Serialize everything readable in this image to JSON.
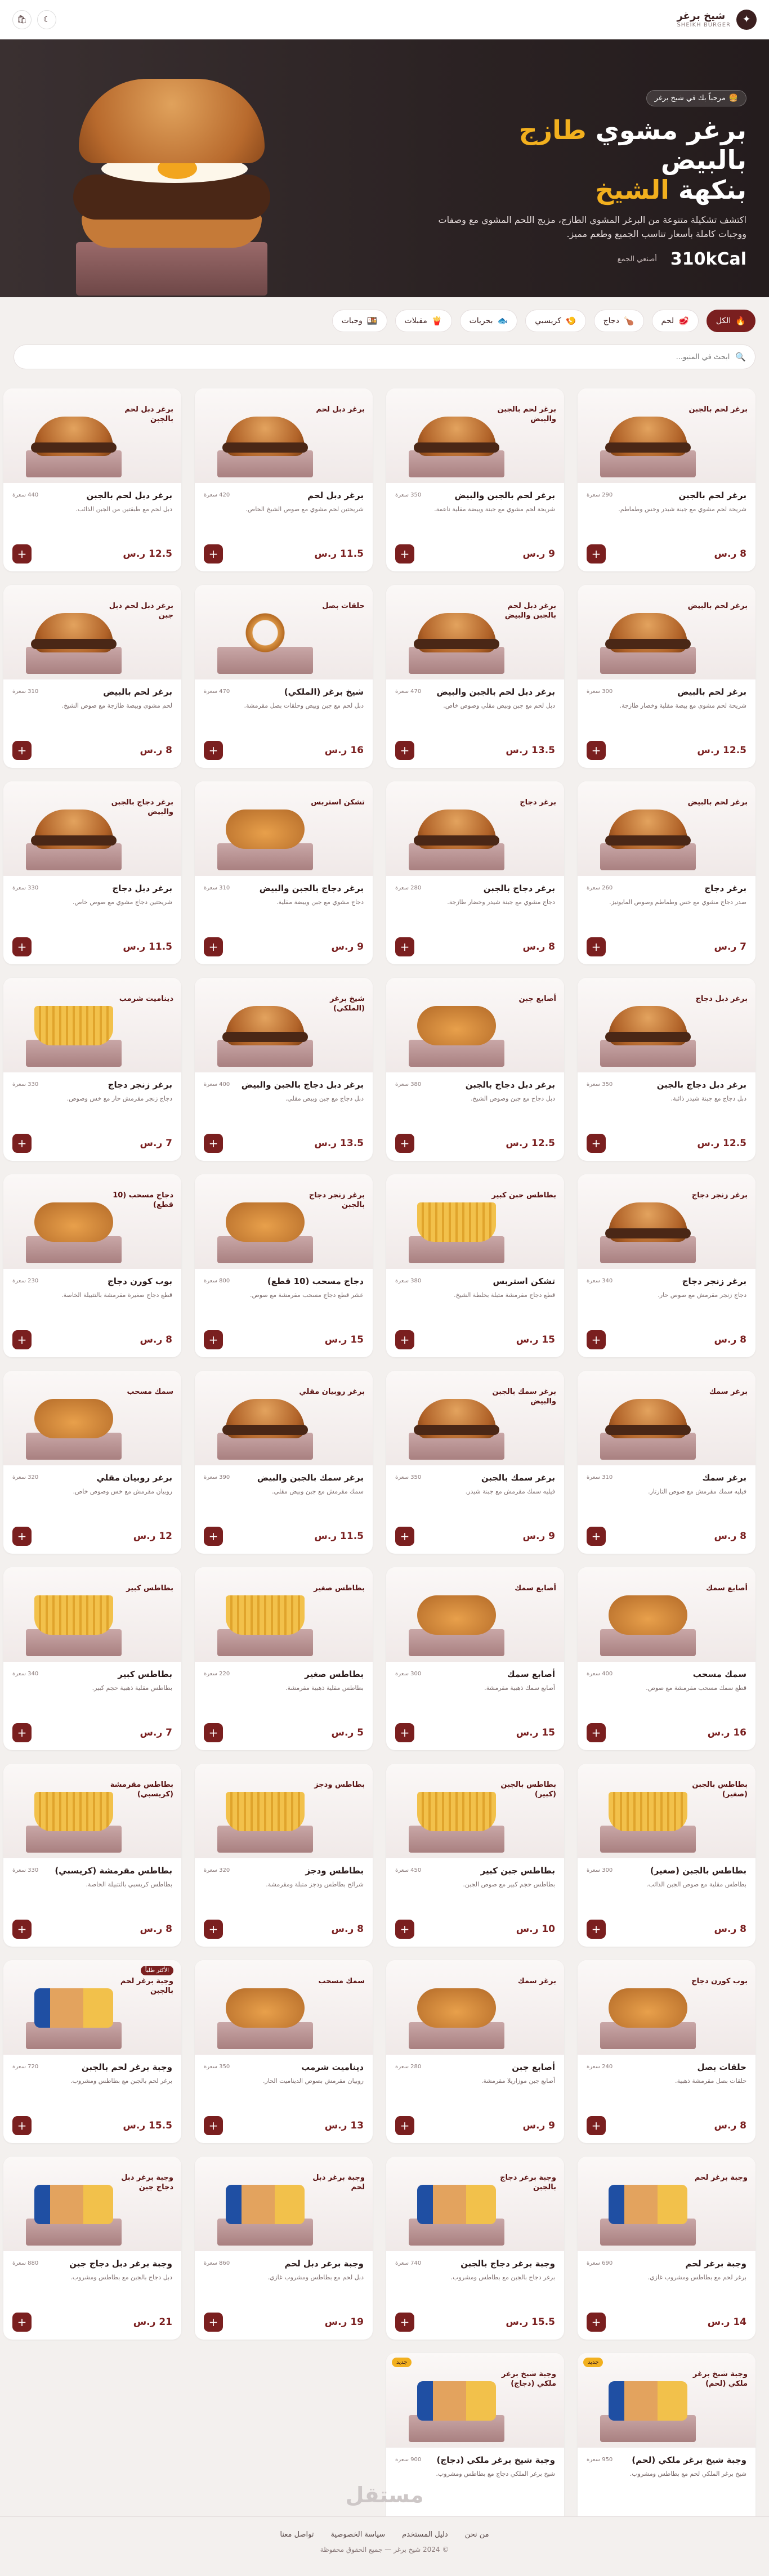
{
  "header": {
    "brand_ar": "شيخ برغر",
    "brand_en": "SHEIKH BURGER",
    "cart_icon": "bag-icon",
    "theme_icon": "moon-icon"
  },
  "hero": {
    "badge": "مرحباً بك في شيخ برغر",
    "title_line1": "برغر مشوي",
    "title_accent1": "طازج",
    "title_line1b": "بالبيض",
    "title_line2": "بنكهة",
    "title_accent2": "الشيخ",
    "description": "اكتشف تشكيلة متنوعة من البرغر المشوي الطازج، مزيج اللحم المشوي مع وصفات ووجبات كاملة بأسعار تناسب الجميع وطعم مميز.",
    "kcal": "310kCal",
    "note": "أصنعي الجمع"
  },
  "categories": [
    {
      "label": "الكل",
      "active": true,
      "icon": "fire-icon",
      "glyph": "🔥"
    },
    {
      "label": "لحم",
      "active": false,
      "icon": "meat-icon",
      "glyph": "🥩"
    },
    {
      "label": "دجاج",
      "active": false,
      "icon": "chicken-icon",
      "glyph": "🍗"
    },
    {
      "label": "كريسبي",
      "active": false,
      "icon": "crispy-icon",
      "glyph": "🍤"
    },
    {
      "label": "بحريات",
      "active": false,
      "icon": "fish-icon",
      "glyph": "🐟"
    },
    {
      "label": "مقبلات",
      "active": false,
      "icon": "fries-icon",
      "glyph": "🍟"
    },
    {
      "label": "وجبات",
      "active": false,
      "icon": "meal-icon",
      "glyph": "🍱"
    }
  ],
  "search": {
    "placeholder": "ابحث في المنيو..."
  },
  "products": [
    {
      "name": "برغر لحم بالجبن",
      "label": "برغر لحم بالجبن",
      "kcal": "290 سعرة",
      "desc": "شريحة لحم مشوي مع جبنة شيدر وخس وطماطم.",
      "price": "8 ر.س",
      "food": "burger"
    },
    {
      "name": "برغر لحم بالجبن والبيض",
      "label": "برغر لحم بالجبن والبيض",
      "kcal": "350 سعرة",
      "desc": "شريحة لحم مشوي مع جبنة وبيضة مقلية ناعمة.",
      "price": "9 ر.س",
      "food": "burger"
    },
    {
      "name": "برغر دبل لحم",
      "label": "برغر دبل لحم",
      "kcal": "420 سعرة",
      "desc": "شريحتين لحم مشوي مع صوص الشيخ الخاص.",
      "price": "11.5 ر.س",
      "food": "burger"
    },
    {
      "name": "برغر دبل لحم بالجبن",
      "label": "برغر دبل لحم بالجبن",
      "kcal": "440 سعرة",
      "desc": "دبل لحم مع طبقتين من الجبن الذائب.",
      "price": "12.5 ر.س",
      "food": "burger"
    },
    {
      "name": "برغر لحم بالبيض",
      "label": "برغر لحم بالبيض",
      "kcal": "300 سعرة",
      "desc": "شريحة لحم مشوي مع بيضة مقلية وخضار طازجة.",
      "price": "12.5 ر.س",
      "food": "burger"
    },
    {
      "name": "برغر دبل لحم بالجبن والبيض",
      "label": "برغر دبل لحم بالجبن والبيض",
      "kcal": "470 سعرة",
      "desc": "دبل لحم مع جبن وبيض مقلي وصوص خاص.",
      "price": "13.5 ر.س",
      "food": "burger"
    },
    {
      "name": "شيخ برغر (الملكي)",
      "label": "حلقات بصل",
      "kcal": "470 سعرة",
      "desc": "دبل لحم مع جبن وبيض وحلقات بصل مقرمشة.",
      "price": "16 ر.س",
      "food": "rings"
    },
    {
      "name": "برغر لحم بالبيض",
      "label": "برغر دبل لحم دبل جبن",
      "kcal": "310 سعرة",
      "desc": "لحم مشوي وبيضة طازجة مع صوص الشيخ.",
      "price": "8 ر.س",
      "food": "burger"
    },
    {
      "name": "برغر دجاج",
      "label": "برغر لحم بالبيض",
      "kcal": "260 سعرة",
      "desc": "صدر دجاج مشوي مع خس وطماطم وصوص المايونيز.",
      "price": "7 ر.س",
      "food": "burger"
    },
    {
      "name": "برغر دجاج بالجبن",
      "label": "برغر دجاج",
      "kcal": "280 سعرة",
      "desc": "دجاج مشوي مع جبنة شيدر وخضار طازجة.",
      "price": "8 ر.س",
      "food": "burger"
    },
    {
      "name": "برغر دجاج بالجبن والبيض",
      "label": "تشكن استربس",
      "kcal": "310 سعرة",
      "desc": "دجاج مشوي مع جبن وبيضة مقلية.",
      "price": "9 ر.س",
      "food": "strips"
    },
    {
      "name": "برغر دبل دجاج",
      "label": "برغر دجاج بالجبن والبيض",
      "kcal": "330 سعرة",
      "desc": "شريحتين دجاج مشوي مع صوص خاص.",
      "price": "11.5 ر.س",
      "food": "burger"
    },
    {
      "name": "برغر دبل دجاج بالجبن",
      "label": "برغر دبل دجاج",
      "kcal": "350 سعرة",
      "desc": "دبل دجاج مع جبنة شيدر ذائبة.",
      "price": "12.5 ر.س",
      "food": "burger"
    },
    {
      "name": "برغر دبل دجاج بالجبن",
      "label": "أصابع جبن",
      "kcal": "380 سعرة",
      "desc": "دبل دجاج مع جبن وصوص الشيخ.",
      "price": "12.5 ر.س",
      "food": "strips"
    },
    {
      "name": "برغر دبل دجاج بالجبن والبيض",
      "label": "شيخ برغر (الملكي)",
      "kcal": "400 سعرة",
      "desc": "دبل دجاج مع جبن وبيض مقلي.",
      "price": "13.5 ر.س",
      "food": "burger"
    },
    {
      "name": "برغر زنجر دجاج",
      "label": "ديناميت شرمب",
      "kcal": "330 سعرة",
      "desc": "دجاج زنجر مقرمش حار مع خس وصوص.",
      "price": "7 ر.س",
      "food": "fries"
    },
    {
      "name": "برغر زنجر دجاج",
      "label": "برغر زنجر دجاج",
      "kcal": "340 سعرة",
      "desc": "دجاج زنجر مقرمش مع صوص حار.",
      "price": "8 ر.س",
      "food": "burger"
    },
    {
      "name": "تشكن استربس",
      "label": "بطاطس جبن كبير",
      "kcal": "380 سعرة",
      "desc": "قطع دجاج مقرمشة متبلة بخلطة الشيخ.",
      "price": "15 ر.س",
      "food": "fries"
    },
    {
      "name": "دجاج مسحب (10 قطع)",
      "label": "برغر زنجر دجاج بالجبن",
      "kcal": "800 سعرة",
      "desc": "عشر قطع دجاج مسحب مقرمشة مع صوص.",
      "price": "15 ر.س",
      "food": "strips"
    },
    {
      "name": "بوب كورن دجاج",
      "label": "دجاج مسحب (10 قطع)",
      "kcal": "230 سعرة",
      "desc": "قطع دجاج صغيرة مقرمشة بالتتبيلة الخاصة.",
      "price": "8 ر.س",
      "food": "strips"
    },
    {
      "name": "برغر سمك",
      "label": "برغر سمك",
      "kcal": "310 سعرة",
      "desc": "فيليه سمك مقرمش مع صوص التارتار.",
      "price": "8 ر.س",
      "food": "burger"
    },
    {
      "name": "برغر سمك بالجبن",
      "label": "برغر سمك بالجبن والبيض",
      "kcal": "350 سعرة",
      "desc": "فيليه سمك مقرمش مع جبنة شيدر.",
      "price": "9 ر.س",
      "food": "burger"
    },
    {
      "name": "برغر سمك بالجبن والبيض",
      "label": "برغر روبيان مقلي",
      "kcal": "390 سعرة",
      "desc": "سمك مقرمش مع جبن وبيض مقلي.",
      "price": "11.5 ر.س",
      "food": "burger"
    },
    {
      "name": "برغر روبيان مقلي",
      "label": "سمك مسحب",
      "kcal": "320 سعرة",
      "desc": "روبيان مقرمش مع خس وصوص خاص.",
      "price": "12 ر.س",
      "food": "strips"
    },
    {
      "name": "سمك مسحب",
      "label": "أصابع سمك",
      "kcal": "400 سعرة",
      "desc": "قطع سمك مسحب مقرمشة مع صوص.",
      "price": "16 ر.س",
      "food": "strips"
    },
    {
      "name": "أصابع سمك",
      "label": "أصابع سمك",
      "kcal": "300 سعرة",
      "desc": "أصابع سمك ذهبية مقرمشة.",
      "price": "15 ر.س",
      "food": "strips"
    },
    {
      "name": "بطاطس صغير",
      "label": "بطاطس صغير",
      "kcal": "220 سعرة",
      "desc": "بطاطس مقلية ذهبية مقرمشة.",
      "price": "5 ر.س",
      "food": "fries"
    },
    {
      "name": "بطاطس كبير",
      "label": "بطاطس كبير",
      "kcal": "340 سعرة",
      "desc": "بطاطس مقلية ذهبية حجم كبير.",
      "price": "7 ر.س",
      "food": "fries"
    },
    {
      "name": "بطاطس بالجبن (صغير)",
      "label": "بطاطس بالجبن (صغير)",
      "kcal": "300 سعرة",
      "desc": "بطاطس مقلية مع صوص الجبن الذائب.",
      "price": "8 ر.س",
      "food": "fries"
    },
    {
      "name": "بطاطس جبن كبير",
      "label": "بطاطس بالجبن (كبير)",
      "kcal": "450 سعرة",
      "desc": "بطاطس حجم كبير مع صوص الجبن.",
      "price": "10 ر.س",
      "food": "fries"
    },
    {
      "name": "بطاطس ودجز",
      "label": "بطاطس ودجز",
      "kcal": "320 سعرة",
      "desc": "شرائح بطاطس ودجز متبلة ومقرمشة.",
      "price": "8 ر.س",
      "food": "fries"
    },
    {
      "name": "بطاطس مقرمشة (كريسبي)",
      "label": "بطاطس مقرمشة (كريسبي)",
      "kcal": "330 سعرة",
      "desc": "بطاطس كريسبي بالتتبيلة الخاصة.",
      "price": "8 ر.س",
      "food": "fries"
    },
    {
      "name": "حلقات بصل",
      "label": "بوب كورن دجاج",
      "kcal": "240 سعرة",
      "desc": "حلقات بصل مقرمشة ذهبية.",
      "price": "8 ر.س",
      "food": "strips"
    },
    {
      "name": "أصابع جبن",
      "label": "برغر سمك",
      "kcal": "280 سعرة",
      "desc": "أصابع جبن موزاريلا مقرمشة.",
      "price": "9 ر.س",
      "food": "strips"
    },
    {
      "name": "ديناميت شرمب",
      "label": "سمك مسحب",
      "kcal": "350 سعرة",
      "desc": "روبيان مقرمش بصوص الديناميت الحار.",
      "price": "13 ر.س",
      "food": "strips"
    },
    {
      "name": "وجبة برغر لحم بالجبن",
      "label": "وجبة برغر لحم بالجبن",
      "badge": "الأكثر طلباً",
      "kcal": "720 سعرة",
      "desc": "برغر لحم بالجبن مع بطاطس ومشروب.",
      "price": "15.5 ر.س",
      "food": "combo"
    },
    {
      "name": "وجبة برغر لحم",
      "label": "وجبة برغر لحم",
      "kcal": "690 سعرة",
      "desc": "برغر لحم مع بطاطس ومشروب غازي.",
      "price": "14 ر.س",
      "food": "combo"
    },
    {
      "name": "وجبة برغر دجاج بالجبن",
      "label": "وجبة برغر دجاج بالجبن",
      "kcal": "740 سعرة",
      "desc": "برغر دجاج بالجبن مع بطاطس ومشروب.",
      "price": "15.5 ر.س",
      "food": "combo"
    },
    {
      "name": "وجبة برغر دبل لحم",
      "label": "وجبة برغر دبل لحم",
      "kcal": "860 سعرة",
      "desc": "دبل لحم مع بطاطس ومشروب غازي.",
      "price": "19 ر.س",
      "food": "combo"
    },
    {
      "name": "وجبة برغر دبل دجاج جبن",
      "label": "وجبة برغر دبل دجاج جبن",
      "kcal": "880 سعرة",
      "desc": "دبل دجاج بالجبن مع بطاطس ومشروب.",
      "price": "21 ر.س",
      "food": "combo"
    },
    {
      "name": "وجبة شيخ برغر ملكي (لحم)",
      "label": "وجبة شيخ برغر ملكي (لحم)",
      "ribbon": "جديد",
      "kcal": "950 سعرة",
      "desc": "شيخ برغر الملكي لحم مع بطاطس ومشروب.",
      "price": "23.5 ر.س",
      "food": "combo"
    },
    {
      "name": "وجبة شيخ برغر ملكي (دجاج)",
      "label": "وجبة شيخ برغر ملكي (دجاج)",
      "ribbon": "جديد",
      "kcal": "900 سعرة",
      "desc": "شيخ برغر الملكي دجاج مع بطاطس ومشروب.",
      "price": "23.5 ر.س",
      "food": "combo"
    }
  ],
  "footer": {
    "links": [
      "من نحن",
      "دليل المستخدم",
      "سياسة الخصوصية",
      "تواصل معنا"
    ],
    "copyright": "© 2024 شيخ برغر — جميع الحقوق محفوظة",
    "watermark": "مستقل"
  },
  "colors": {
    "accent": "#7a1f1f",
    "gold": "#f2b01e",
    "hero_bg": "#2b2223"
  }
}
